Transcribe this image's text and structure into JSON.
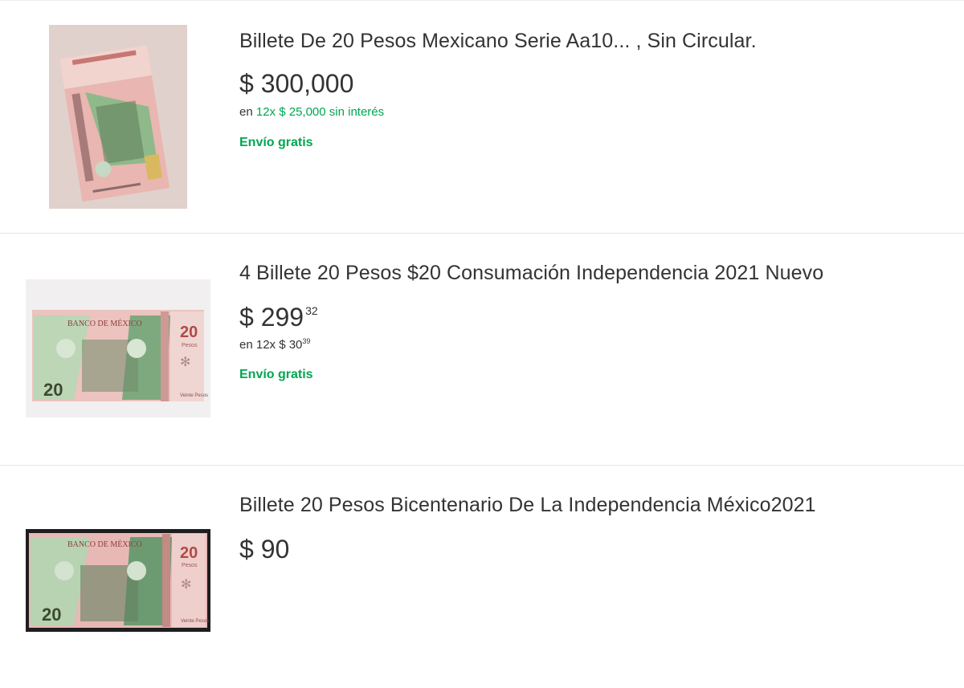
{
  "listings": [
    {
      "title": "Billete De 20 Pesos Mexicano Serie Aa10... , Sin Circular.",
      "price": "$ 300,000",
      "installments_prefix": "en",
      "installments_text": "12x $ 25,000 sin interés",
      "shipping": "Envío gratis"
    },
    {
      "title": "4 Billete 20 Pesos $20 Consumación Independencia 2021 Nuevo",
      "price_main": "$ 299",
      "price_cents": "32",
      "installments_text": "en 12x $ 30",
      "installments_cents": "39",
      "shipping": "Envío gratis"
    },
    {
      "title": "Billete 20 Pesos Bicentenario De La Independencia México2021",
      "price": "$ 90"
    }
  ],
  "banknote": {
    "bank_name": "BANCO DE MÉXICO",
    "denomination": "20",
    "denomination_word": "Pesos",
    "value_text": "Veinte Pesos"
  },
  "colors": {
    "text": "#333333",
    "green": "#00a650",
    "divider": "#e6e6e6"
  }
}
